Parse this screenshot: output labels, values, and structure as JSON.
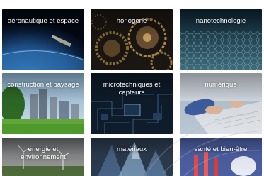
{
  "tiles": [
    {
      "label": "aéronautique et espace"
    },
    {
      "label": "horlogerie"
    },
    {
      "label": "nanotechnologie"
    },
    {
      "label": "construction et paysage"
    },
    {
      "label": "microtechniques et capteurs"
    },
    {
      "label": "numérique"
    },
    {
      "label": "énergie et environnement"
    },
    {
      "label": "matériaux"
    },
    {
      "label": "santé et bien-être"
    }
  ]
}
